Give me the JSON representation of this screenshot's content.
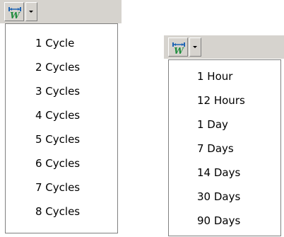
{
  "cycles_dropdown": {
    "button_icon": "time-window-icon",
    "items": [
      "1 Cycle",
      "2 Cycles",
      "3 Cycles",
      "4 Cycles",
      "5 Cycles",
      "6 Cycles",
      "7 Cycles",
      "8 Cycles"
    ]
  },
  "time_dropdown": {
    "button_icon": "time-window-icon",
    "items": [
      "1 Hour",
      "12 Hours",
      "1 Day",
      "7 Days",
      "14 Days",
      "30 Days",
      "90 Days"
    ]
  },
  "colors": {
    "icon_blue": "#1e64b4",
    "icon_green": "#1e8c3c"
  }
}
